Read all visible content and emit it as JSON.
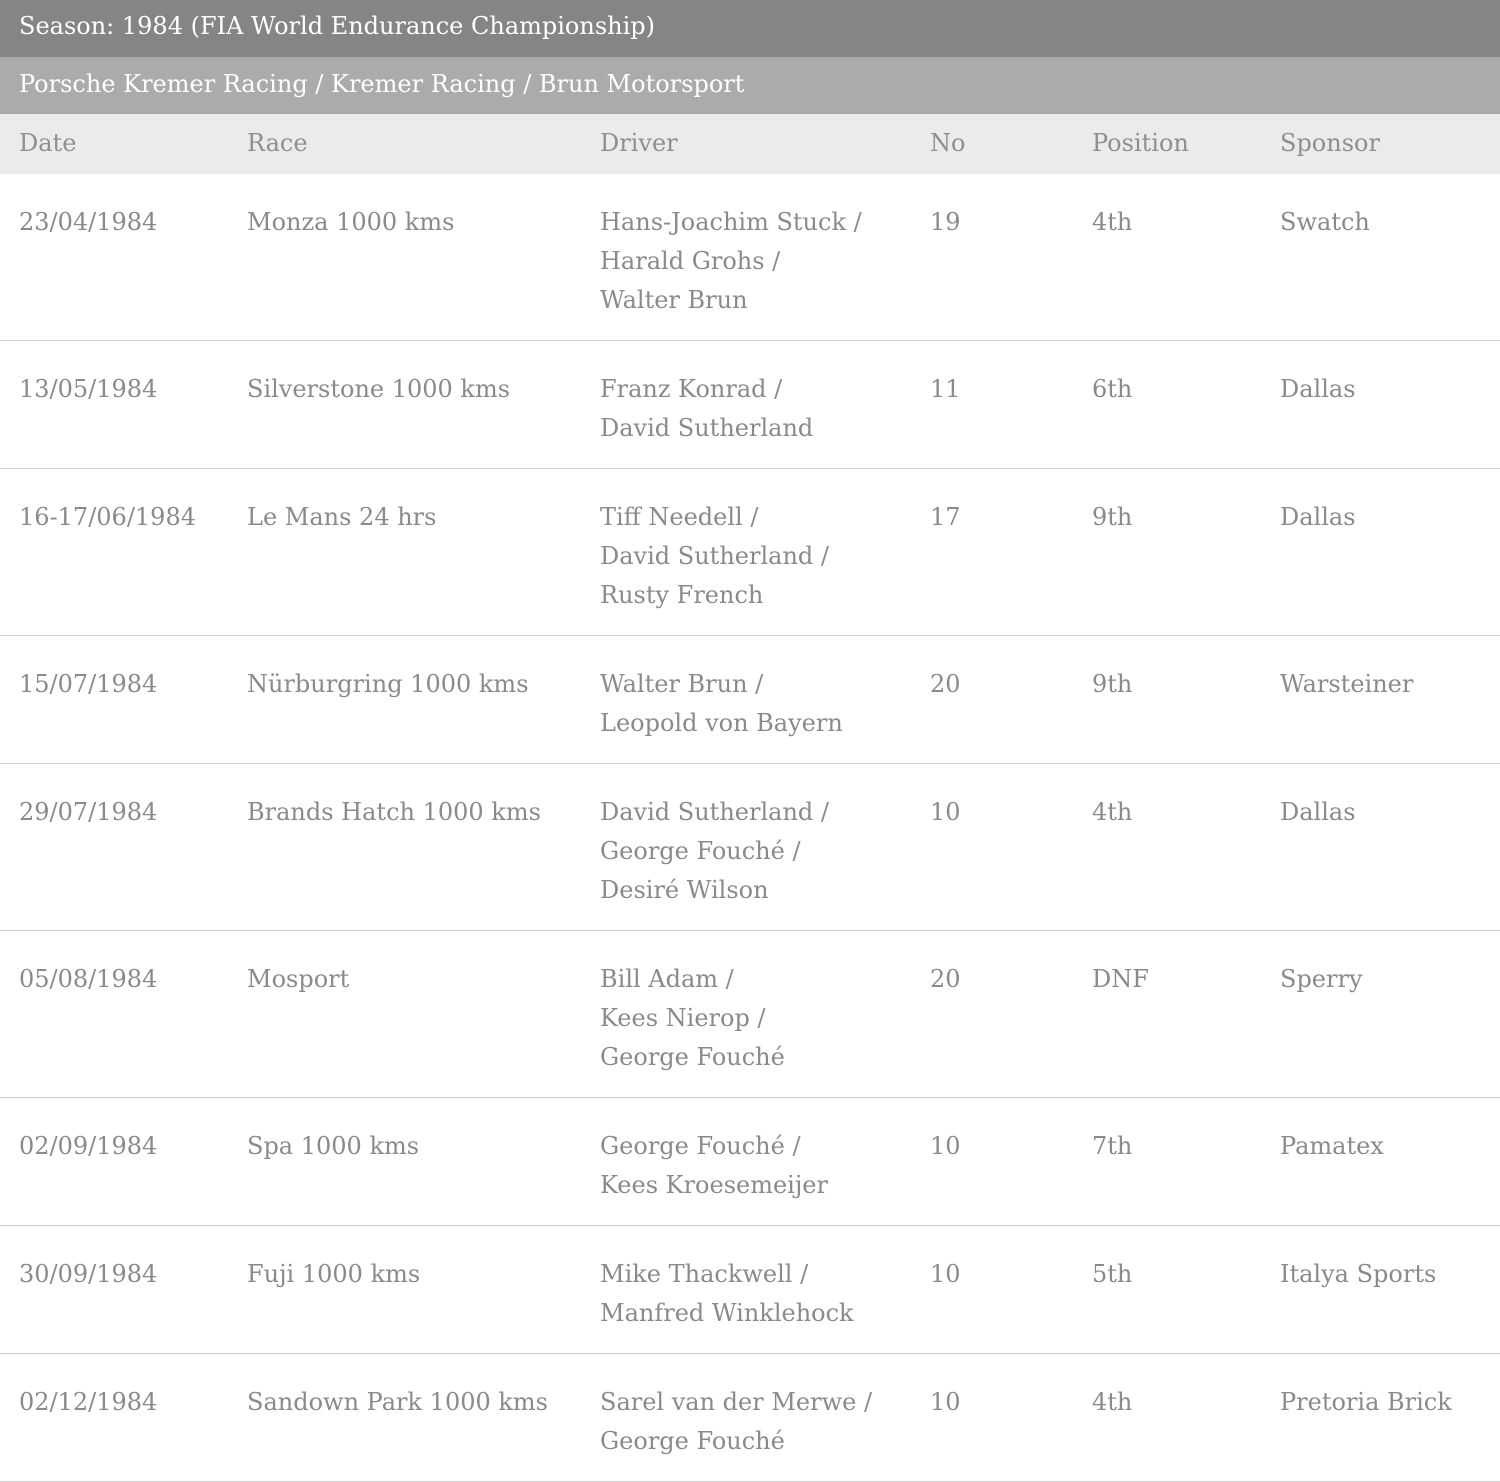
{
  "season_title": "Season: 1984 (FIA World Endurance Championship)",
  "team_title": "Porsche Kremer Racing / Kremer Racing / Brun Motorsport",
  "columns": {
    "date": "Date",
    "race": "Race",
    "driver": "Driver",
    "no": "No",
    "position": "Position",
    "sponsor": "Sponsor"
  },
  "rows": [
    {
      "date": "23/04/1984",
      "race": "Monza 1000 kms",
      "drivers": [
        "Hans-Joachim Stuck /",
        "Harald Grohs /",
        "Walter Brun"
      ],
      "no": "19",
      "position": "4th",
      "sponsor": "Swatch"
    },
    {
      "date": "13/05/1984",
      "race": "Silverstone 1000 kms",
      "drivers": [
        "Franz Konrad /",
        "David Sutherland"
      ],
      "no": "11",
      "position": "6th",
      "sponsor": "Dallas"
    },
    {
      "date": "16-17/06/1984",
      "race": "Le Mans 24 hrs",
      "drivers": [
        "Tiff Needell /",
        "David Sutherland /",
        "Rusty French"
      ],
      "no": "17",
      "position": "9th",
      "sponsor": "Dallas"
    },
    {
      "date": "15/07/1984",
      "race": "Nürburgring 1000 kms",
      "drivers": [
        "Walter Brun /",
        "Leopold von Bayern"
      ],
      "no": "20",
      "position": "9th",
      "sponsor": "Warsteiner"
    },
    {
      "date": "29/07/1984",
      "race": "Brands Hatch 1000 kms",
      "drivers": [
        "David Sutherland /",
        "George Fouché /",
        "Desiré Wilson"
      ],
      "no": "10",
      "position": "4th",
      "sponsor": "Dallas"
    },
    {
      "date": "05/08/1984",
      "race": "Mosport",
      "drivers": [
        "Bill Adam /",
        "Kees Nierop /",
        "George Fouché"
      ],
      "no": "20",
      "position": "DNF",
      "sponsor": "Sperry"
    },
    {
      "date": "02/09/1984",
      "race": "Spa 1000 kms",
      "drivers": [
        "George Fouché /",
        "Kees Kroesemeijer"
      ],
      "no": "10",
      "position": "7th",
      "sponsor": "Pamatex"
    },
    {
      "date": "30/09/1984",
      "race": "Fuji 1000 kms",
      "drivers": [
        "Mike Thackwell /",
        "Manfred Winklehock"
      ],
      "no": "10",
      "position": "5th",
      "sponsor": "Italya Sports"
    },
    {
      "date": "02/12/1984",
      "race": "Sandown Park 1000 kms",
      "drivers": [
        "Sarel van der Merwe /",
        "George Fouché"
      ],
      "no": "10",
      "position": "4th",
      "sponsor": "Pretoria Brick"
    }
  ]
}
